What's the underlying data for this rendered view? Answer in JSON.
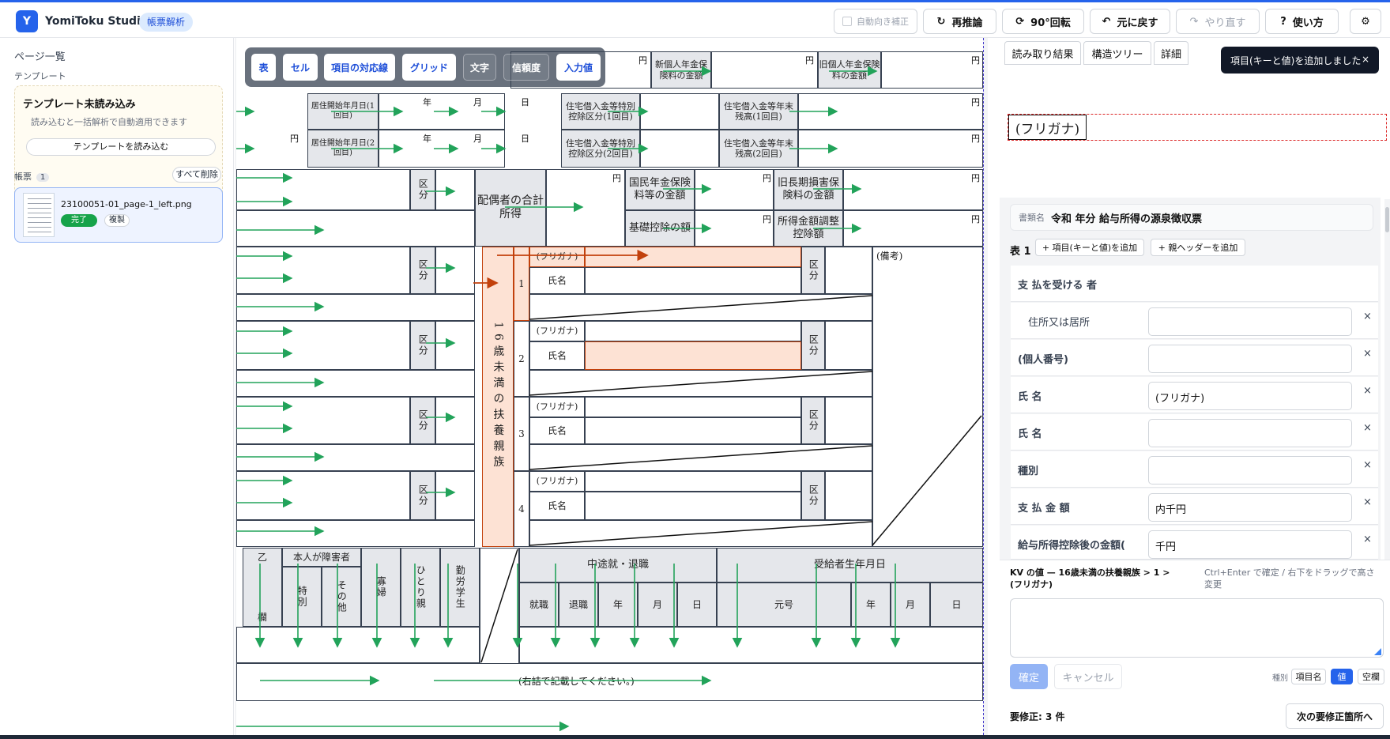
{
  "app": {
    "logo_letter": "Y",
    "name": "YomiToku Studio",
    "mode_badge": "帳票解析"
  },
  "toolbar": {
    "auto_orient": "自動向き補正",
    "reinfer": "再推論",
    "rotate": "90°回転",
    "undo": "元に戻す",
    "redo": "やり直す",
    "help": "使い方",
    "settings": "⚙",
    "reinfer_icon": "↻",
    "rotate_icon": "⟳",
    "undo_icon": "↶",
    "redo_icon": "↷",
    "help_icon": "?"
  },
  "sidebar": {
    "title": "ページ一覧",
    "template_section": "テンプレート",
    "template_card": {
      "title": "テンプレート未読み込み",
      "desc": "読み込むと一括解析で自動適用できます",
      "button": "テンプレートを読み込む"
    },
    "ledger_label": "帳票",
    "ledger_count": "1",
    "clear_all": "すべて削除",
    "doc": {
      "filename": "23100051-01_page-1_left.png",
      "status": "完了",
      "duplicate": "複製"
    }
  },
  "overlay_buttons": [
    {
      "label": "表",
      "state": "on"
    },
    {
      "label": "セル",
      "state": "on"
    },
    {
      "label": "項目の対応線",
      "state": "on"
    },
    {
      "label": "グリッド",
      "state": "on"
    },
    {
      "label": "文字",
      "state": "off"
    },
    {
      "label": "信頼度",
      "state": "off"
    },
    {
      "label": "入力値",
      "state": "on"
    }
  ],
  "document": {
    "new_pension": "新個人年金保険料の金額",
    "old_pension": "旧個人年金保険料の金額",
    "resid1": "居住開始年月日(1回目)",
    "resid2": "居住開始年月日(2回目)",
    "loan1": "住宅借入金等特別控除区分(1回目)",
    "loan2": "住宅借入金等特別控除区分(2回目)",
    "bal1": "住宅借入金等年末残高(1回目)",
    "bal2": "住宅借入金等年末残高(2回目)",
    "spouse": "配偶者の合計所得",
    "natl_pension": "国民年金保険料等の金額",
    "old_long": "旧長期損害保険料の金額",
    "basic": "基礎控除の額",
    "adjust": "所得金額調整控除額",
    "kubun": "区分",
    "dependents": "16歳未満の扶養親族",
    "furigana": "(フリガナ)",
    "name": "氏名",
    "remarks": "(備考)",
    "n1": "1",
    "n2": "2",
    "n3": "3",
    "n4": "4",
    "otsu": "乙",
    "otsu2": "欄",
    "disabled": "本人が障害者",
    "special": "特別",
    "other": "その他",
    "widow": "寡婦",
    "single": "ひとり親",
    "student": "勤労学生",
    "midway": "中途就・退職",
    "employ": "就職",
    "retire": "退職",
    "birth": "受給者生年月日",
    "era": "元号",
    "year": "年",
    "month": "月",
    "day": "日",
    "yen": "円",
    "right_note": "(右詰で記載してください。)"
  },
  "right_panel": {
    "tabs": [
      "読み取り結果",
      "構造ツリー",
      "詳細"
    ],
    "toast": "項目(キーと値)を追加しました",
    "toast_close": "×",
    "crop_text": "(フリガナ)",
    "doc_name_key": "書類名",
    "doc_name_value": "令和 年分 給与所得の源泉徴収票",
    "table_label": "表 1",
    "add_kv": "+ 項目(キーと値)を追加",
    "add_parent": "+ 親ヘッダーを追加",
    "rows": [
      {
        "label": "支 払を受ける 者",
        "value": null,
        "indent": false
      },
      {
        "label": "住所又は居所",
        "value": "",
        "indent": true
      },
      {
        "label": "(個人番号)",
        "value": "",
        "indent": false
      },
      {
        "label": "氏 名",
        "value": "(フリガナ)",
        "indent": false
      },
      {
        "label": "氏 名",
        "value": "",
        "indent": false
      },
      {
        "label": "種別",
        "value": "",
        "indent": false
      },
      {
        "label": "支 払 金 額",
        "value": "内千円",
        "indent": false
      },
      {
        "label": "給与所得控除後の金額(",
        "value": "千円",
        "indent": false
      }
    ],
    "delete": "×",
    "editor": {
      "header": "KV の値 — 16歳未満の扶養親族 > 1 > (フリガナ)",
      "hint": "Ctrl+Enter で確定 / 右下をドラッグで高さ変更",
      "confirm": "確定",
      "cancel": "キャンセル",
      "kind_label": "種別",
      "kinds": [
        "項目名",
        "値",
        "空欄"
      ],
      "kind_selected": "値",
      "need_fix": "要修正: 3 件",
      "next_fix": "次の要修正箇所へ"
    }
  },
  "colors": {
    "accent": "#2563eb",
    "green": "#16a34a",
    "arrow": "#22a35a",
    "highlight": "#fde2d4",
    "highlight_border": "#c2410c"
  }
}
